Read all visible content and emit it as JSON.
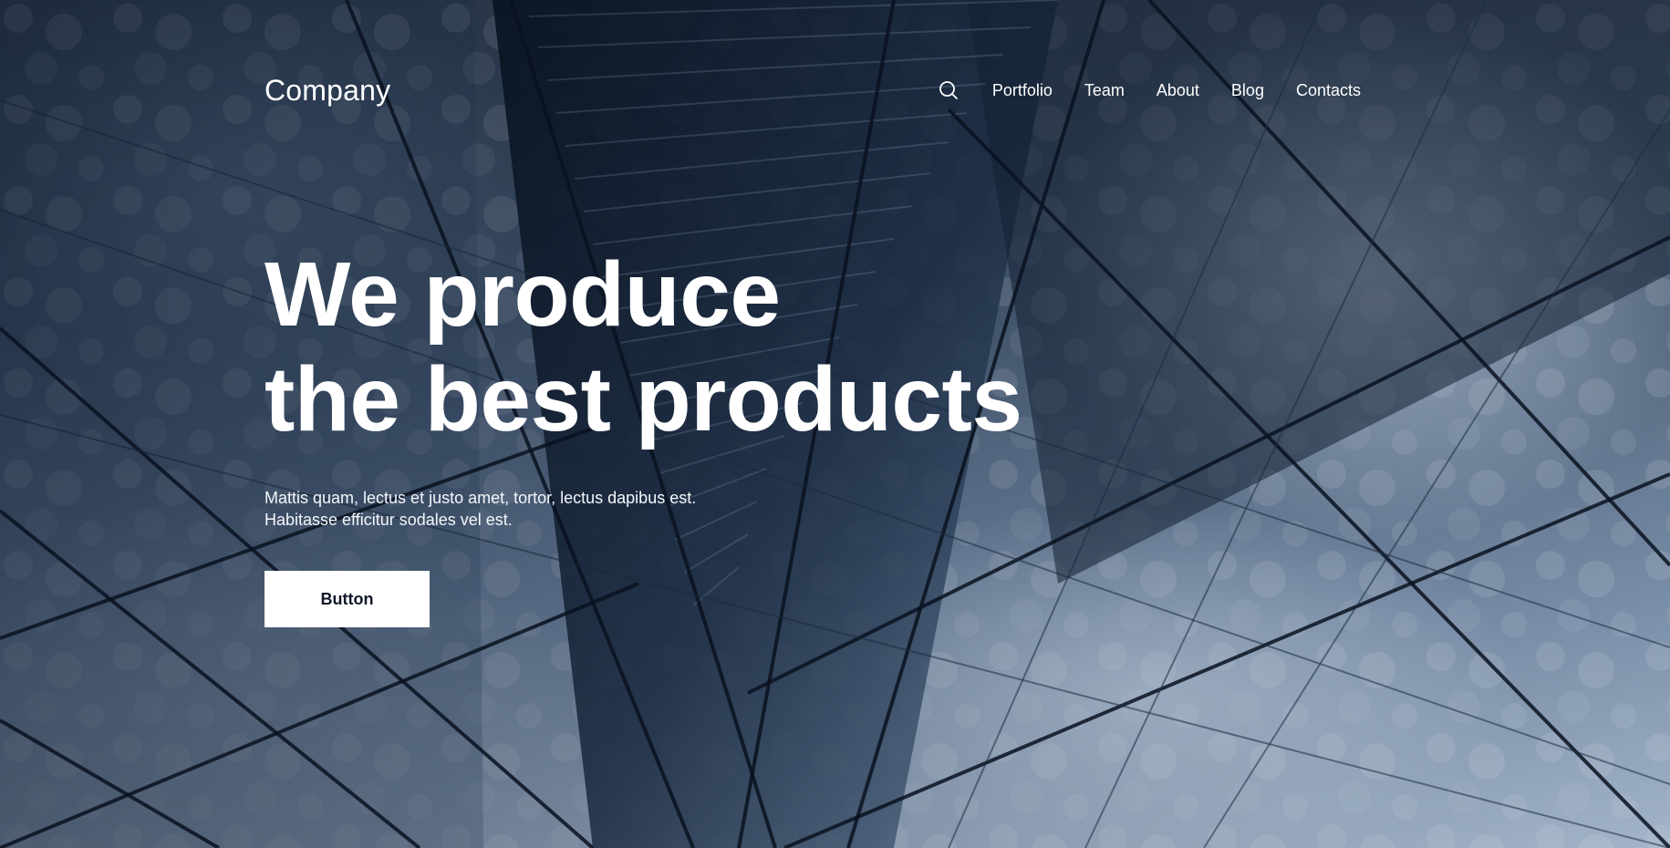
{
  "header": {
    "logo": "Company",
    "search_icon": "search-icon",
    "nav": [
      {
        "label": "Portfolio"
      },
      {
        "label": "Team"
      },
      {
        "label": "About"
      },
      {
        "label": "Blog"
      },
      {
        "label": "Contacts"
      }
    ]
  },
  "hero": {
    "headline": [
      "We produce",
      "the best products"
    ],
    "subtext": [
      "Mattis quam, lectus et justo amet, tortor, lectus dapibus est.",
      "Habitasse efficitur sodales vel est."
    ],
    "button_label": "Button"
  },
  "colors": {
    "text": "#ffffff",
    "button_bg": "#ffffff",
    "button_text": "#101827",
    "overlay": "#1b2a40"
  }
}
